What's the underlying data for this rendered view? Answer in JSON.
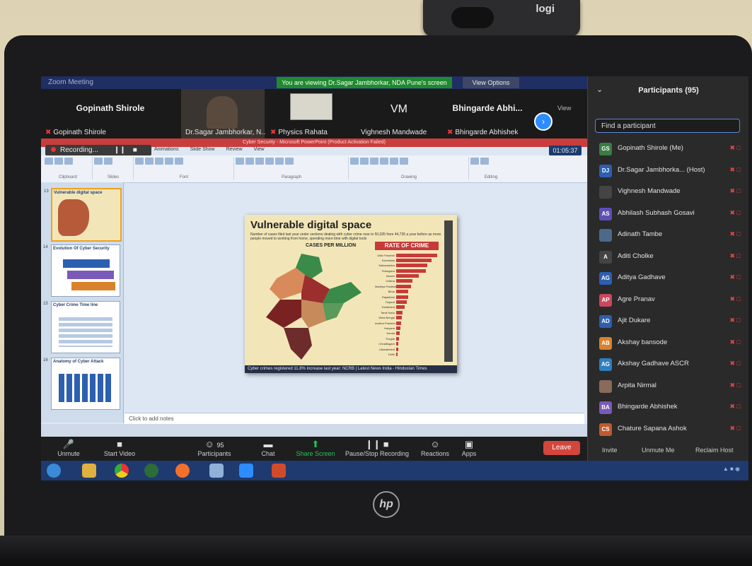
{
  "webcam": {
    "brand": "logi"
  },
  "laptop": {
    "brand": "hp"
  },
  "zoom": {
    "title": "Zoom Meeting",
    "viewing_banner": "You are viewing Dr.Sagar Jambhorkar, NDA Pune's screen",
    "view_options": "View Options",
    "view_label": "View",
    "tiles": [
      {
        "big": "Gopinath Shirole",
        "name": "Gopinath Shirole",
        "muted": true
      },
      {
        "big": "",
        "name": "Dr.Sagar Jambhorkar, N...",
        "muted": false
      },
      {
        "big": "",
        "name": "Physics Rahata",
        "muted": true
      },
      {
        "big": "VM",
        "name": "Vighnesh Mandwade",
        "muted": false
      },
      {
        "big": "Bhingarde Abhi...",
        "name": "Bhingarde Abhishek",
        "muted": true
      }
    ],
    "recording": "Recording...",
    "timer": "01:05:37",
    "toolbar": {
      "unmute": "Unmute",
      "start_video": "Start Video",
      "participants": "Participants",
      "participants_count": "95",
      "chat": "Chat",
      "share_screen": "Share Screen",
      "pause_recording": "Pause/Stop Recording",
      "reactions": "Reactions",
      "apps": "Apps",
      "leave": "Leave"
    },
    "participants_panel": {
      "title": "Participants (95)",
      "search_placeholder": "Find a participant",
      "list": [
        {
          "initials": "GS",
          "name": "Gopinath Shirole (Me)",
          "color": "#3a7d44"
        },
        {
          "initials": "DJ",
          "name": "Dr.Sagar Jambhorka... (Host)",
          "color": "#2d5fb0"
        },
        {
          "initials": "",
          "name": "Vighnesh Mandwade",
          "color": "#444444"
        },
        {
          "initials": "AS",
          "name": "Abhilash Subhash Gosavi",
          "color": "#5d4fb5"
        },
        {
          "initials": "",
          "name": "Adinath Tambe",
          "color": "#4a6a88"
        },
        {
          "initials": "A",
          "name": "Aditi Cholke",
          "color": "#444444"
        },
        {
          "initials": "AG",
          "name": "Aditya Gadhave",
          "color": "#2d5fb0"
        },
        {
          "initials": "AP",
          "name": "Agre Pranav",
          "color": "#c9485b"
        },
        {
          "initials": "AD",
          "name": "Ajit Dukare",
          "color": "#2d5fb0"
        },
        {
          "initials": "AB",
          "name": "Akshay bansode",
          "color": "#d9822b"
        },
        {
          "initials": "AG",
          "name": "Akshay Gadhave ASCR",
          "color": "#2d7fc0"
        },
        {
          "initials": "",
          "name": "Arpita Nirmal",
          "color": "#8a6a5a"
        },
        {
          "initials": "BA",
          "name": "Bhingarde Abhishek",
          "color": "#7a5ab8"
        },
        {
          "initials": "CS",
          "name": "Chature Sapana Ashok",
          "color": "#c05a2d"
        }
      ],
      "invite": "Invite",
      "unmute_me": "Unmute Me",
      "reclaim_host": "Reclaim Host"
    }
  },
  "powerpoint": {
    "title_bar": "Cyber Security - Microsoft PowerPoint (Product Activation Failed)",
    "tabs": [
      "Animations",
      "Slide Show",
      "Review",
      "View"
    ],
    "ribbon_groups": [
      "Clipboard",
      "Slides",
      "Font",
      "Paragraph",
      "Drawing",
      "Editing"
    ],
    "thumbnails": [
      {
        "num": "13",
        "title": "Vulnerable digital space"
      },
      {
        "num": "14",
        "title": "Evolution Of Cyber Security"
      },
      {
        "num": "15",
        "title": "Cyber Crime Time line"
      },
      {
        "num": "16",
        "title": "Anatomy of Cyber Attack"
      }
    ],
    "notes_placeholder": "Click to add notes",
    "slide": {
      "title": "Vulnerable digital space",
      "subtitle": "Number of cases filed last year under sections dealing with cyber crime rose to 50,035 from 44,735 a year before as more people moved to working from home, spending more time with digital tools",
      "cases_heading": "CASES PER MILLION",
      "rate_heading": "RATE OF CRIME",
      "caption": "Cyber crimes registered 11.8% increase last year: NCRB | Latest News India - Hindustan Times",
      "states": [
        "Uttar Pradesh",
        "Karnataka",
        "Maharashtra",
        "Telangana",
        "Assam",
        "Odisha",
        "Madhya Pradesh",
        "Bihar",
        "Rajasthan",
        "Gujarat",
        "Jharkhand",
        "Tamil Nadu",
        "West Bengal",
        "Andhra Pradesh",
        "Haryana",
        "Kerala",
        "Punjab",
        "Chhattisgarh",
        "Uttarakhand",
        "Delhi"
      ],
      "bar_levels": [
        1.0,
        0.86,
        0.75,
        0.72,
        0.55,
        0.4,
        0.36,
        0.3,
        0.3,
        0.25,
        0.2,
        0.16,
        0.14,
        0.12,
        0.1,
        0.08,
        0.07,
        0.06,
        0.05,
        0.04
      ]
    }
  }
}
